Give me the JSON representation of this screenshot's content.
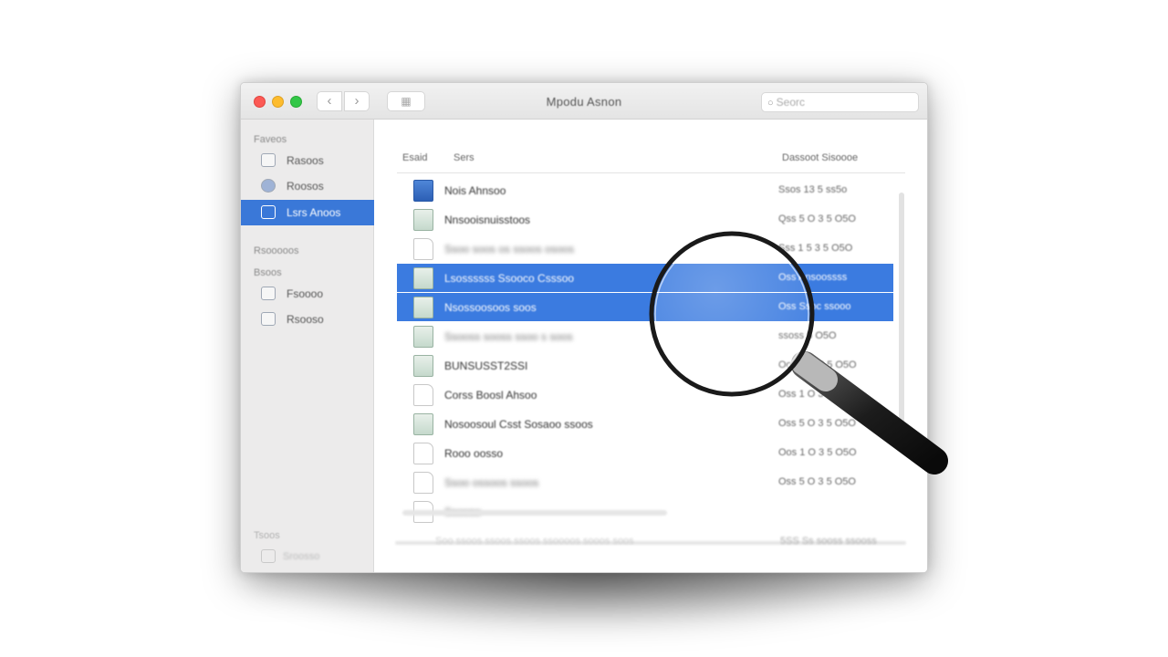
{
  "window": {
    "title": "Mpodu Asnon",
    "nav_back": "‹",
    "nav_fwd": "›",
    "view_icon": "grid-icon",
    "search_placeholder": "Seorc"
  },
  "sidebar": {
    "sections": [
      {
        "header": "Faveos",
        "items": [
          {
            "label": "Rasoos",
            "icon": "document-icon"
          },
          {
            "label": "Roosos",
            "icon": "globe-icon"
          },
          {
            "label": "Lsrs Anoos",
            "icon": "folder-icon",
            "active": true
          }
        ]
      },
      {
        "header": "Rsooooos",
        "items": []
      },
      {
        "header": "Bsoos",
        "items": [
          {
            "label": "Fsoooo",
            "icon": "window-icon"
          },
          {
            "label": "Rsooso",
            "icon": "grid-icon"
          }
        ]
      }
    ],
    "footer": {
      "header": "Tsoos",
      "item": "Sroosso"
    }
  },
  "columns": {
    "name": "Esaid",
    "kind": "Sers",
    "date": "Dassoot Sisoooe"
  },
  "rows": [
    {
      "name": "Nois Ahnsoo",
      "date": "Ssos 13 5 ss5o",
      "icon": "blue",
      "blur": false,
      "selected": false
    },
    {
      "name": "Nnsooisnuisstoos",
      "date": "Qss 5 O 3 5 O5O",
      "icon": "img",
      "blur": false,
      "selected": false
    },
    {
      "name": "Ssoo soos os ssoos osoos",
      "date": "Sss 1 5 3 5 O5O",
      "icon": "doc",
      "blur": true,
      "selected": false
    },
    {
      "name": "Lsossssss Ssooco Csssoo",
      "date": "Oss Ansoossss",
      "icon": "img",
      "blur": false,
      "selected": true
    },
    {
      "name": "Nsossoosoos soos",
      "date": "Oss Ssoc ssooo",
      "icon": "img",
      "blur": false,
      "selected": true
    },
    {
      "name": "Ssooss sooss ssoo s soos",
      "date": "ssoss 5 O5O",
      "icon": "img",
      "blur": true,
      "selected": false
    },
    {
      "name": "BUNSUSST2SSI",
      "date": "Oos 1 O 3 5 O5O",
      "icon": "img",
      "blur": false,
      "selected": false
    },
    {
      "name": "Corss Boosl Ahsoo",
      "date": "Oss 1 O 3 5 O5O",
      "icon": "doc",
      "blur": false,
      "selected": false
    },
    {
      "name": "Nosoosoul Csst Sosaoo ssoos",
      "date": "Oss 5 O 3 5 O5O",
      "icon": "img",
      "blur": false,
      "selected": false
    },
    {
      "name": "Rooo oosso",
      "date": "Oos 1 O 3 5 O5O",
      "icon": "doc",
      "blur": false,
      "selected": false
    },
    {
      "name": "Ssoo ossoos ssoos",
      "date": "Oss 5 O 3 5 O5O",
      "icon": "doc",
      "blur": true,
      "selected": false
    },
    {
      "name": "Ssooso",
      "date": "",
      "icon": "doc",
      "blur": true,
      "selected": false
    }
  ],
  "status": {
    "left": "Soo ssoos ssoos ssoos ssoooos sooos soos",
    "right": "5SS  Ss sooss ssooss"
  },
  "overlay": {
    "icon": "magnifying-glass-icon"
  }
}
